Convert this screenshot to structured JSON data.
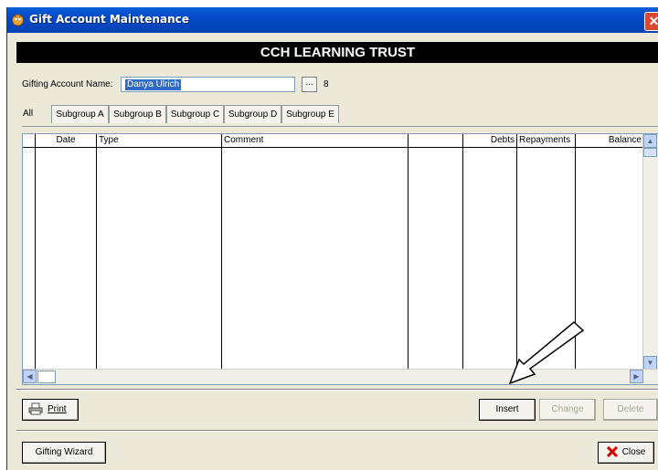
{
  "window": {
    "title": "Gift Account Maintenance",
    "close_glyph": "✕"
  },
  "banner": "CCH LEARNING TRUST",
  "account": {
    "label": "Gifting Account Name:",
    "value": "Danya Ulrich",
    "browse": "...",
    "number": "8"
  },
  "tabs": [
    "All",
    "Subgroup A",
    "Subgroup B",
    "Subgroup C",
    "Subgroup D",
    "Subgroup E"
  ],
  "grid": {
    "columns": [
      "",
      "Date",
      "Type",
      "Comment",
      "",
      "Debts",
      "Repayments",
      "Balance"
    ],
    "rows": []
  },
  "buttons": {
    "print": "Print",
    "insert": "Insert",
    "change": "Change",
    "delete": "Delete",
    "wizard": "Gifting Wizard",
    "close": "Close"
  },
  "icons": {
    "app": "app-icon",
    "printer": "printer-icon",
    "close_x": "red-x-icon"
  },
  "colors": {
    "titlebar": "#0548c7",
    "banner": "#000000",
    "selection": "#316ac5",
    "close_x": "#cc0000"
  }
}
